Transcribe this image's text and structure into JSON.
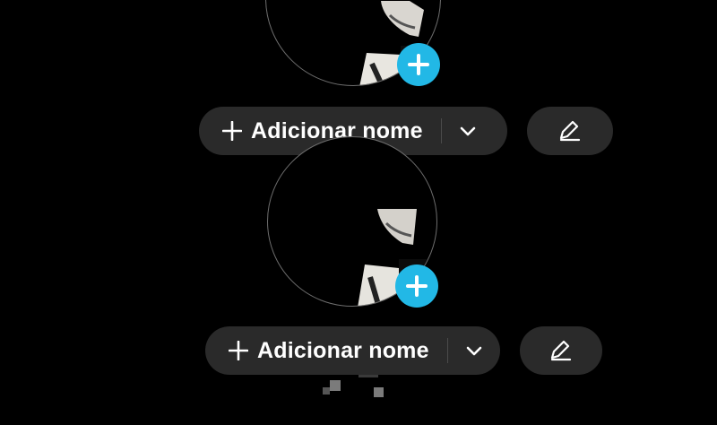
{
  "profiles": [
    {
      "add_name_label": "Adicionar nome"
    },
    {
      "add_name_label": "Adicionar nome"
    }
  ],
  "icons": {
    "plus": "plus-icon",
    "chevron": "chevron-down-icon",
    "pencil": "pencil-icon",
    "add_photo": "add-photo-icon"
  },
  "colors": {
    "background": "#000000",
    "pill": "#2a2a2a",
    "accent": "#22b8e6",
    "text": "#ffffff"
  }
}
